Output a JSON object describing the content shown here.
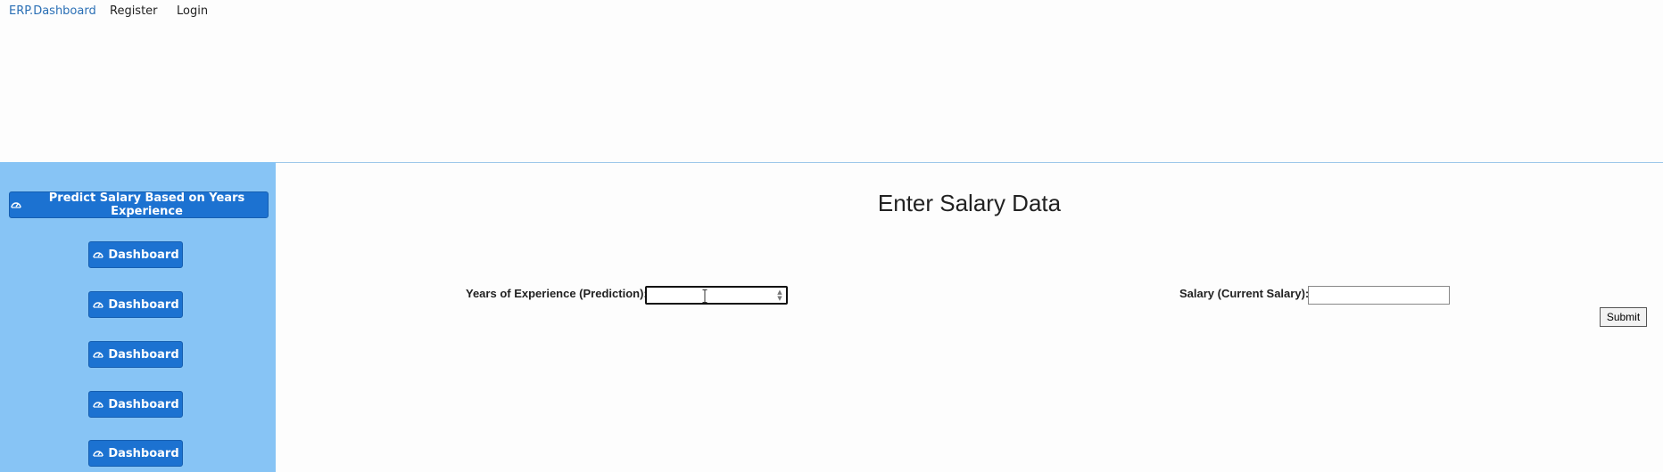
{
  "nav": {
    "brand": "ERP.Dashboard",
    "links": [
      "Register",
      "Login"
    ]
  },
  "sidebar": {
    "predict_label": "Predict Salary Based on Years Experience",
    "items": [
      {
        "label": "Dashboard"
      },
      {
        "label": "Dashboard"
      },
      {
        "label": "Dashboard"
      },
      {
        "label": "Dashboard"
      },
      {
        "label": "Dashboard"
      }
    ],
    "icon": "dashboard-gauge-icon",
    "button_color": "#1c72d1",
    "panel_color": "#87c4f5"
  },
  "main": {
    "title": "Enter Salary Data",
    "form": {
      "years_label": "Years of Experience (Prediction):",
      "years_value": "",
      "salary_label": "Salary (Current Salary):",
      "salary_value": "",
      "submit_label": "Submit"
    }
  }
}
